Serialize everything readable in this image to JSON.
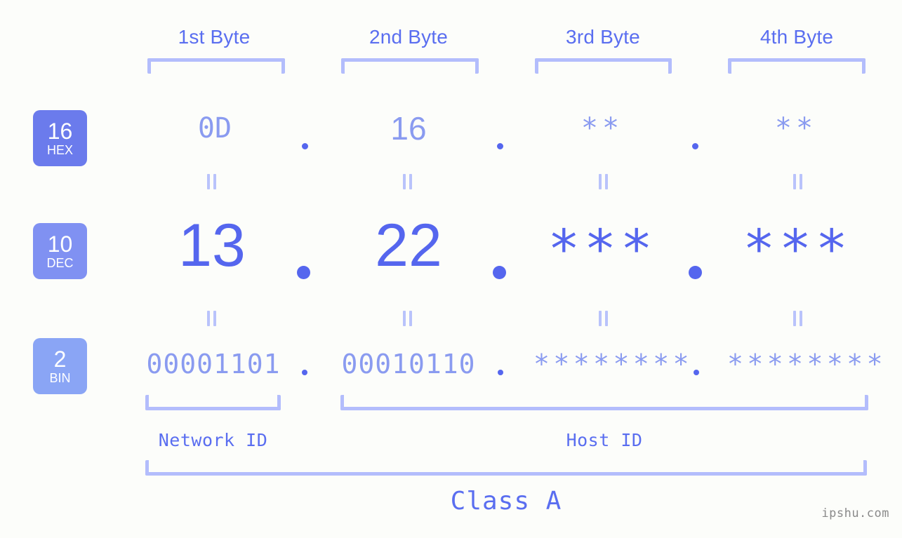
{
  "background": "#fcfdfa",
  "colors": {
    "header_blue": "#5a6ef0",
    "bracket_blue": "#b3bdfc",
    "dec_blue": "#5566ee",
    "light_blue": "#8a9bf0",
    "eq_blue": "#b9c3fb",
    "badge_hex": "#6b7bec",
    "badge_dec": "#8091f2",
    "badge_bin": "#8aa5f5",
    "watermark_gray": "#8a8a8a"
  },
  "byte_headers": [
    {
      "label": "1st Byte"
    },
    {
      "label": "2nd Byte"
    },
    {
      "label": "3rd Byte"
    },
    {
      "label": "4th Byte"
    }
  ],
  "bases": [
    {
      "number": "16",
      "name": "HEX"
    },
    {
      "number": "10",
      "name": "DEC"
    },
    {
      "number": "2",
      "name": "BIN"
    }
  ],
  "rows": {
    "hex": {
      "base_number": "16",
      "base_name": "HEX",
      "values": [
        "0D",
        "16",
        "**",
        "**"
      ],
      "separators": [
        ".",
        ".",
        "."
      ]
    },
    "dec": {
      "base_number": "10",
      "base_name": "DEC",
      "values": [
        "13",
        "22",
        "***",
        "***"
      ],
      "separators": [
        ".",
        ".",
        "."
      ]
    },
    "bin": {
      "base_number": "2",
      "base_name": "BIN",
      "values": [
        "00001101",
        "00010110",
        "********",
        "********"
      ],
      "separators": [
        ".",
        ".",
        "."
      ]
    }
  },
  "equality_marks": {
    "symbol": "=",
    "count_per_row": 4,
    "rows": 2
  },
  "id_labels": {
    "network": "Network ID",
    "host": "Host ID"
  },
  "class_label": "Class A",
  "watermark": "ipshu.com"
}
